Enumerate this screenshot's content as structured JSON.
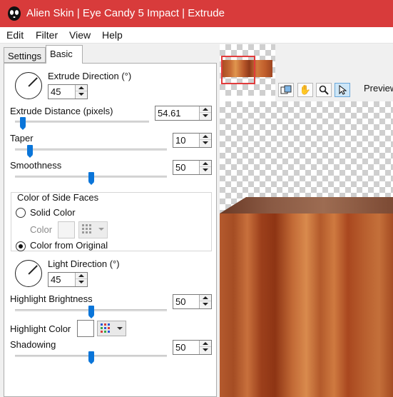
{
  "window": {
    "title": "Alien Skin | Eye Candy 5 Impact | Extrude"
  },
  "menu": [
    "Edit",
    "Filter",
    "View",
    "Help"
  ],
  "tabs": {
    "settings": "Settings",
    "basic": "Basic"
  },
  "extrude_direction": {
    "label": "Extrude Direction (°)",
    "value": "45"
  },
  "extrude_distance": {
    "label": "Extrude Distance (pixels)",
    "value": "54.61",
    "slider_fraction": 0.06
  },
  "taper": {
    "label": "Taper",
    "value": "10",
    "slider_fraction": 0.1
  },
  "smoothness": {
    "label": "Smoothness",
    "value": "50",
    "slider_fraction": 0.5
  },
  "side_faces": {
    "title": "Color of Side Faces",
    "solid_color": "Solid Color",
    "color_label": "Color",
    "color_from_original": "Color from Original",
    "selected": "color_from_original"
  },
  "light_direction": {
    "label": "Light Direction (°)",
    "value": "45"
  },
  "highlight_brightness": {
    "label": "Highlight Brightness",
    "value": "50",
    "slider_fraction": 0.5
  },
  "highlight_color": {
    "label": "Highlight Color",
    "color": "#ffffff"
  },
  "shadowing": {
    "label": "Shadowing",
    "value": "50",
    "slider_fraction": 0.5
  },
  "preview": {
    "label": "Preview"
  },
  "icons": {
    "app_logo": "alien-skin-logo-icon",
    "compare": "compare-icon",
    "pan": "hand-icon",
    "zoom": "magnifier-icon",
    "select": "arrow-pointer-icon"
  },
  "colors": {
    "titlebar": "#d83b3b",
    "slider_thumb": "#0a75d9",
    "active_tool": "#cde6f7"
  }
}
